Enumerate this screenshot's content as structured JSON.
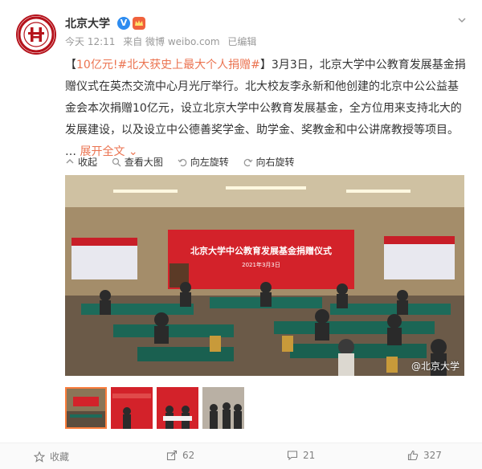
{
  "post": {
    "author": "北京大学",
    "verified_badge": "V",
    "meta": {
      "time": "今天 12:11",
      "source": "来自 微博 weibo.com",
      "edited": "已编辑"
    },
    "text": {
      "open_bracket": "【",
      "amount": "10亿元!",
      "hashtag": "#北大获史上最大个人捐赠#",
      "close_bracket": "】",
      "body": "3月3日，北京大学中公教育发展基金捐赠仪式在英杰交流中心月光厅举行。北大校友李永新和他创建的北京中公公益基金会本次捐赠10亿元，设立北京大学中公教育发展基金，全方位用来支持北大的发展建设，以及设立中公德善奖学金、助学金、奖教金和中公讲席教授等项目。",
      "ellipsis": "…",
      "expand_label": "展开全文",
      "expand_icon": "chevron-down-icon"
    },
    "toolbar": {
      "collapse": "收起",
      "view_large": "查看大图",
      "rotate_left": "向左旋转",
      "rotate_right": "向右旋转"
    },
    "image": {
      "banner_title": "北京大学中公教育发展基金捐赠仪式",
      "banner_date": "2021年3月3日",
      "watermark": "@北京大学"
    },
    "thumbnails": [
      {
        "label": "thumb-1",
        "active": true
      },
      {
        "label": "thumb-2",
        "active": false
      },
      {
        "label": "thumb-3",
        "active": false
      },
      {
        "label": "thumb-4",
        "active": false
      }
    ],
    "actions": {
      "favorite": "收藏",
      "share_count": "62",
      "comment_count": "21",
      "like_count": "327"
    }
  }
}
